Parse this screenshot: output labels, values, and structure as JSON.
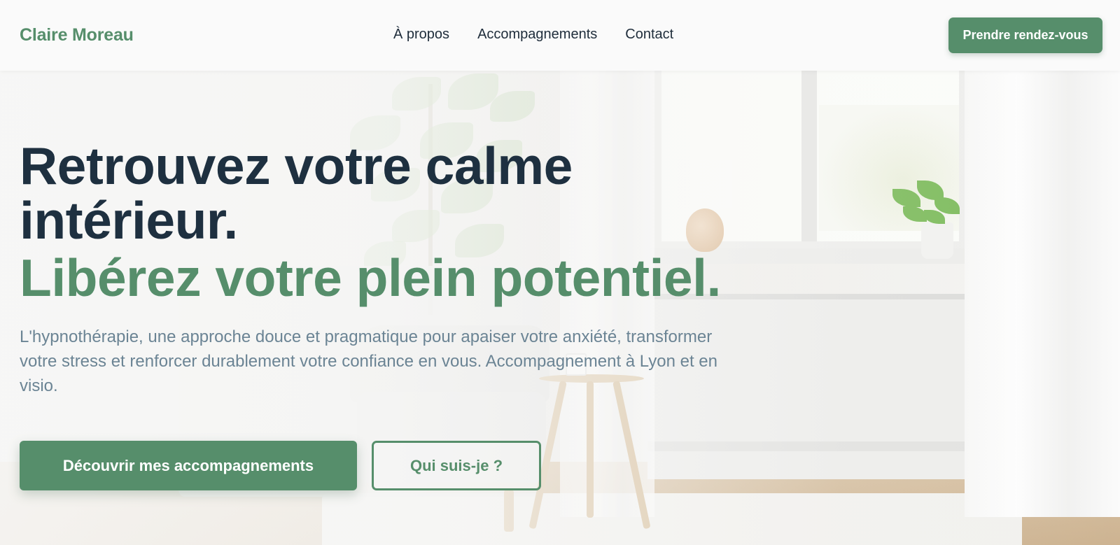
{
  "header": {
    "brand": "Claire Moreau",
    "nav": [
      {
        "label": "À propos"
      },
      {
        "label": "Accompagnements"
      },
      {
        "label": "Contact"
      }
    ],
    "cta_label": "Prendre rendez-vous"
  },
  "hero": {
    "title": "Retrouvez votre calme intérieur.",
    "accent": "Libérez votre plein potentiel.",
    "subtitle": "L'hypnothérapie, une approche douce et pragmatique pour apaiser votre anxiété, transformer votre stress et renforcer durablement votre confiance en vous. Accompagnement à Lyon et en visio.",
    "primary_button": "Découvrir mes accompagnements",
    "secondary_button": "Qui suis-je ?"
  },
  "colors": {
    "brand_green": "#568e6b",
    "heading_navy": "#1e3040",
    "body_text": "#6b8494"
  }
}
